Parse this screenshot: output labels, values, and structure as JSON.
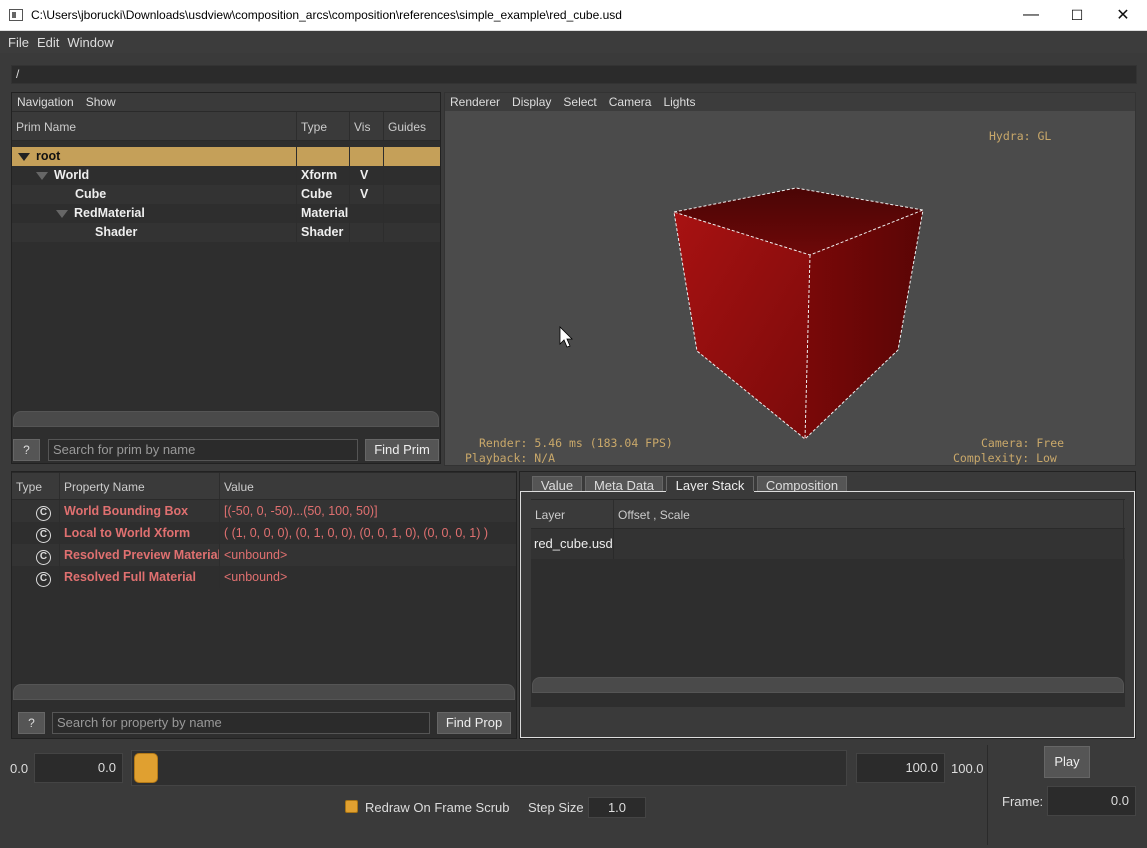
{
  "window": {
    "title": "C:\\Users\\jborucki\\Downloads\\usdview\\composition_arcs\\composition\\references\\simple_example\\red_cube.usd",
    "min_glyph": "—",
    "max_glyph": "☐",
    "close_glyph": "✕"
  },
  "menu": {
    "file": "File",
    "edit": "Edit",
    "window": "Window"
  },
  "path": "/",
  "prim_panel": {
    "menu": {
      "navigation": "Navigation",
      "show": "Show"
    },
    "headers": {
      "name": "Prim Name",
      "type": "Type",
      "vis": "Vis",
      "guides": "Guides"
    },
    "rows": [
      {
        "name": "root",
        "type": "",
        "vis": ""
      },
      {
        "name": "World",
        "type": "Xform",
        "vis": "V"
      },
      {
        "name": "Cube",
        "type": "Cube",
        "vis": "V"
      },
      {
        "name": "RedMaterial",
        "type": "Material",
        "vis": ""
      },
      {
        "name": "Shader",
        "type": "Shader",
        "vis": ""
      }
    ],
    "help": "?",
    "search_placeholder": "Search for prim by name",
    "find": "Find Prim"
  },
  "viewport": {
    "menu": {
      "renderer": "Renderer",
      "display": "Display",
      "select": "Select",
      "camera": "Camera",
      "lights": "Lights"
    },
    "hydra": "Hydra: GL",
    "render": "Render: 5.46 ms (183.04 FPS)",
    "playback": "Playback: N/A",
    "camera": "Camera: Free",
    "complexity": "Complexity: Low",
    "cube_color": "#8a0a0a"
  },
  "prop_panel": {
    "headers": {
      "type": "Type",
      "name": "Property Name",
      "value": "Value"
    },
    "rows": [
      {
        "icon": "C",
        "name": "World Bounding Box",
        "value": "[(-50, 0, -50)...(50, 100, 50)]"
      },
      {
        "icon": "C",
        "name": "Local to World Xform",
        "value": "( (1, 0, 0, 0), (0, 1, 0, 0), (0, 0, 1, 0), (0, 0, 0, 1) )"
      },
      {
        "icon": "C",
        "name": "Resolved Preview Material",
        "value": "<unbound>"
      },
      {
        "icon": "C",
        "name": "Resolved Full Material",
        "value": "<unbound>"
      }
    ],
    "help": "?",
    "search_placeholder": "Search for property by name",
    "find": "Find Prop"
  },
  "right_panel": {
    "tabs": {
      "value": "Value",
      "meta": "Meta Data",
      "layer": "Layer Stack",
      "comp": "Composition"
    },
    "headers": {
      "layer": "Layer",
      "offset": "Offset , Scale"
    },
    "rows": [
      {
        "layer": "red_cube.usd",
        "offset": ""
      }
    ]
  },
  "timeline": {
    "start_label": "0.0",
    "start_value": "0.0",
    "end_value": "100.0",
    "end_label": "100.0",
    "redraw_label": "Redraw On Frame Scrub",
    "step_label": "Step Size",
    "step_value": "1.0",
    "play": "Play",
    "frame_label": "Frame:",
    "frame_value": "0.0",
    "accent": "#e0a030"
  }
}
